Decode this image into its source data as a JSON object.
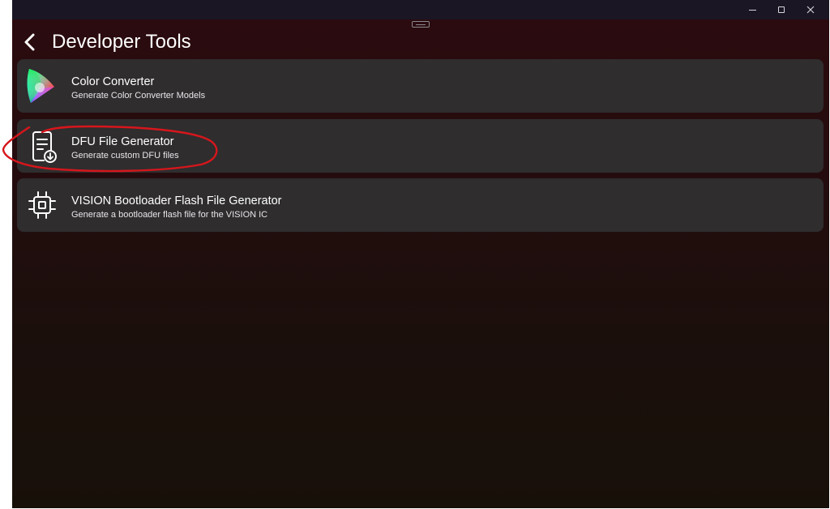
{
  "window": {
    "controls": {
      "minimize_icon": "minimize-icon",
      "maximize_icon": "maximize-icon",
      "close_icon": "close-icon"
    }
  },
  "header": {
    "back_icon": "chevron-left-icon",
    "title": "Developer Tools"
  },
  "tools": [
    {
      "icon": "color-gamut-icon",
      "title": "Color Converter",
      "subtitle": "Generate Color Converter Models"
    },
    {
      "icon": "document-download-icon",
      "title": "DFU File Generator",
      "subtitle": "Generate custom DFU files"
    },
    {
      "icon": "chip-icon",
      "title": "VISION Bootloader Flash File Generator",
      "subtitle": "Generate a bootloader flash file for the VISION IC"
    }
  ],
  "colors": {
    "background_top": "#2c0b0f",
    "background_bottom": "#171009",
    "card": "#2f2d2e",
    "annotation": "#d6161c",
    "titlebar": "#1a1624"
  }
}
